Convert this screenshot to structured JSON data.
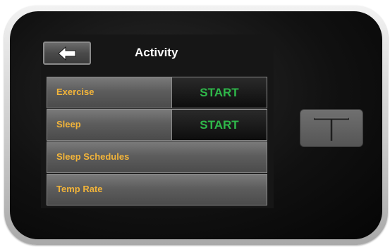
{
  "header": {
    "title": "Activity",
    "back_icon": "arrow-left-icon"
  },
  "menu": {
    "items": [
      {
        "label": "Exercise",
        "action_label": "START"
      },
      {
        "label": "Sleep",
        "action_label": "START"
      },
      {
        "label": "Sleep Schedules"
      },
      {
        "label": "Temp Rate"
      }
    ]
  },
  "device": {
    "button_icon": "t-logo-icon"
  },
  "colors": {
    "label": "#f2b43a",
    "start": "#2fb84a",
    "screen_bg": "#161616"
  }
}
